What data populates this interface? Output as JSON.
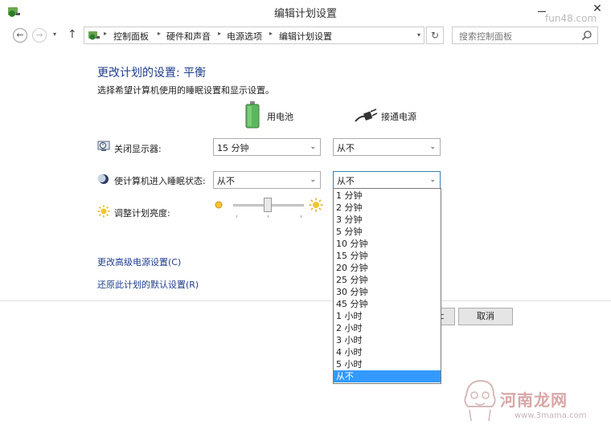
{
  "window": {
    "title": "编辑计划设置",
    "close_glyph": "✕",
    "watermark": "fun48.com"
  },
  "nav": {
    "back_glyph": "←",
    "forward_glyph": "→",
    "dropdown_glyph": "▾",
    "up_glyph": "↑",
    "breadcrumbs": [
      "控制面板",
      "硬件和声音",
      "电源选项",
      "编辑计划设置"
    ],
    "separator": "▸",
    "refresh_glyph": "↻",
    "search_placeholder": "搜索控制面板"
  },
  "main": {
    "heading": "更改计划的设置: 平衡",
    "subheading": "选择希望计算机使用的睡眠设置和显示设置。",
    "col_battery": "用电池",
    "col_plugged": "接通电源",
    "rows": {
      "display_off": {
        "label": "关闭显示器:",
        "battery": "15 分钟",
        "plugged": "从不"
      },
      "sleep": {
        "label": "使计算机进入睡眠状态:",
        "battery": "从不",
        "plugged": "从不"
      },
      "brightness": {
        "label": "调整计划亮度:"
      }
    },
    "combo_arrow": "⌄",
    "links": {
      "advanced": "更改高级电源设置(C)",
      "restore": "还原此计划的默认设置(R)"
    },
    "buttons": {
      "save_partial": "c",
      "cancel": "取消"
    }
  },
  "dropdown": {
    "options": [
      "1 分钟",
      "2 分钟",
      "3 分钟",
      "5 分钟",
      "10 分钟",
      "15 分钟",
      "20 分钟",
      "25 分钟",
      "30 分钟",
      "45 分钟",
      "1 小时",
      "2 小时",
      "3 小时",
      "4 小时",
      "5 小时",
      "从不"
    ],
    "selected": "从不"
  },
  "watermark_bottom": {
    "brand": "河南龙网",
    "url": "www.3mama.com"
  },
  "colors": {
    "link": "#1e3d8f",
    "selected": "#3399ff",
    "heading": "#1e3d8f"
  }
}
